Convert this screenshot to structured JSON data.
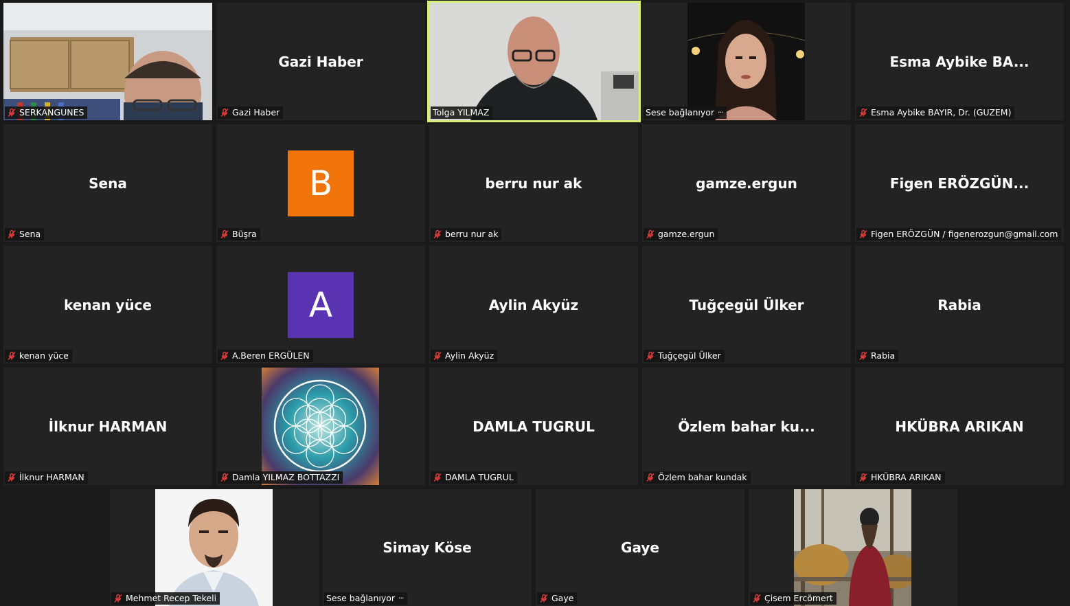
{
  "tiles": [
    {
      "label": "SERKANGUNES",
      "center": "",
      "muted": true
    },
    {
      "label": "Gazi Haber",
      "center": "Gazi Haber",
      "muted": true
    },
    {
      "label": "Tolga YILMAZ",
      "center": "",
      "muted": false
    },
    {
      "label": "Sese bağlanıyor",
      "center": "",
      "muted": false,
      "connecting": true
    },
    {
      "label": "Esma Aybike BAYIR, Dr. (GUZEM)",
      "center": "Esma Aybike BA...",
      "muted": true
    },
    {
      "label": "Sena",
      "center": "Sena",
      "muted": true
    },
    {
      "label": "Büşra",
      "center": "",
      "muted": true,
      "letter": "B"
    },
    {
      "label": "berru nur ak",
      "center": "berru nur ak",
      "muted": true
    },
    {
      "label": "gamze.ergun",
      "center": "gamze.ergun",
      "muted": true
    },
    {
      "label": "Figen ERÖZGÜN / figenerozgun@gmail.com",
      "center": "Figen  ERÖZGÜN...",
      "muted": true
    },
    {
      "label": "kenan yüce",
      "center": "kenan yüce",
      "muted": true
    },
    {
      "label": "A.Beren ERGÜLEN",
      "center": "",
      "muted": true,
      "letter": "A"
    },
    {
      "label": "Aylin Akyüz",
      "center": "Aylin Akyüz",
      "muted": true
    },
    {
      "label": "Tuğçegül Ülker",
      "center": "Tuğçegül Ülker",
      "muted": true
    },
    {
      "label": "Rabia",
      "center": "Rabia",
      "muted": true
    },
    {
      "label": "İlknur HARMAN",
      "center": "İlknur HARMAN",
      "muted": true
    },
    {
      "label": "Damla YILMAZ BOTTAZZI",
      "center": "",
      "muted": true
    },
    {
      "label": "DAMLA TUGRUL",
      "center": "DAMLA TUGRUL",
      "muted": true
    },
    {
      "label": "Özlem bahar kundak",
      "center": "Özlem bahar  ku...",
      "muted": true
    },
    {
      "label": "HKÜBRA ARIKAN",
      "center": "HKÜBRA ARIKAN",
      "muted": true
    },
    {
      "label": "Mehmet Recep Tekeli",
      "center": "",
      "muted": true
    },
    {
      "label": "Sese bağlanıyor",
      "center": "Simay Köse",
      "muted": false,
      "connecting": true
    },
    {
      "label": "Gaye",
      "center": "Gaye",
      "muted": true
    },
    {
      "label": "Çisem Ercömert",
      "center": "",
      "muted": true
    }
  ],
  "connecting_dots": "···",
  "colors": {
    "background": "#1a1a1a",
    "tile": "#232323",
    "active_speaker": "#d6f07a",
    "mute_icon": "#e23c3c",
    "avatar_b": "#f07409",
    "avatar_a": "#5a33b3"
  },
  "icons": {
    "muted": "mic-muted-icon",
    "more": "ellipsis-icon"
  }
}
